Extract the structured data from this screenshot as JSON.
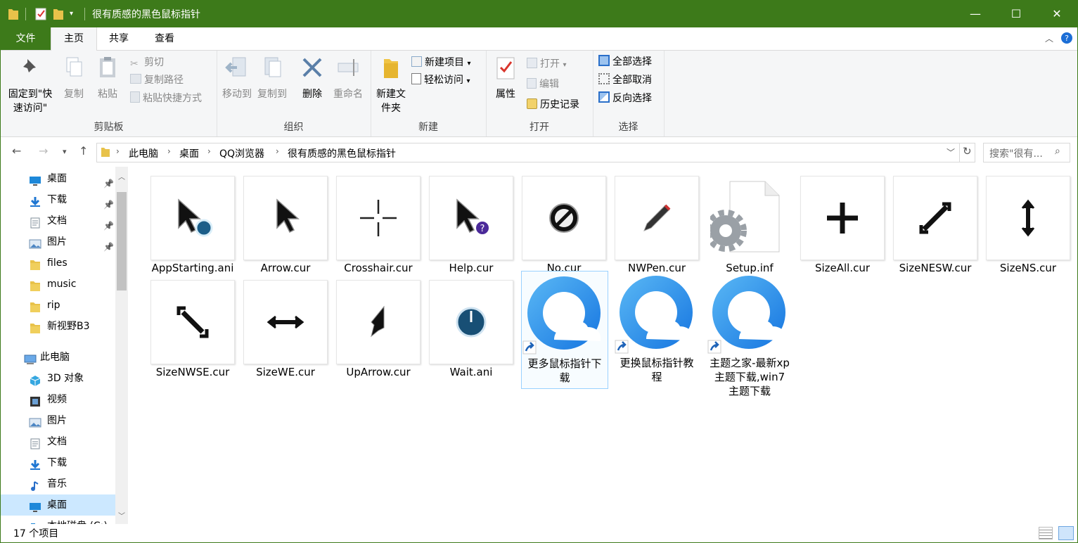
{
  "window": {
    "title": "很有质感的黑色鼠标指针",
    "accent": "#3d7a1a",
    "controls": {
      "minimize": "—",
      "maximize": "☐",
      "close": "✕"
    }
  },
  "ribbon_tabs": [
    "文件",
    "主页",
    "共享",
    "查看"
  ],
  "ribbon": {
    "clipboard": {
      "label": "剪贴板",
      "pin": "固定到\"快速访问\"",
      "copy": "复制",
      "paste": "粘贴",
      "cut": "剪切",
      "copy_path": "复制路径",
      "paste_shortcut": "粘贴快捷方式"
    },
    "organize": {
      "label": "组织",
      "move_to": "移动到",
      "copy_to": "复制到",
      "delete": "删除",
      "rename": "重命名"
    },
    "new": {
      "label": "新建",
      "new_folder": "新建文件夹",
      "new_item": "新建项目",
      "easy_access": "轻松访问"
    },
    "open": {
      "label": "打开",
      "properties": "属性",
      "open": "打开",
      "edit": "编辑",
      "history": "历史记录"
    },
    "select": {
      "label": "选择",
      "select_all": "全部选择",
      "select_none": "全部取消",
      "invert": "反向选择"
    }
  },
  "address": {
    "breadcrumbs": [
      "此电脑",
      "桌面",
      "QQ浏览器",
      "很有质感的黑色鼠标指针"
    ],
    "search_placeholder": "搜索\"很有..."
  },
  "nav_pane": [
    {
      "label": "桌面",
      "icon": "desktop-icon",
      "pinned": true
    },
    {
      "label": "下载",
      "icon": "download-icon",
      "pinned": true
    },
    {
      "label": "文档",
      "icon": "document-icon",
      "pinned": true
    },
    {
      "label": "图片",
      "icon": "picture-icon",
      "pinned": true
    },
    {
      "label": "files",
      "icon": "folder-icon",
      "pinned": false
    },
    {
      "label": "music",
      "icon": "folder-icon",
      "pinned": false
    },
    {
      "label": "rip",
      "icon": "folder-icon",
      "pinned": false
    },
    {
      "label": "新视野B3",
      "icon": "folder-icon",
      "pinned": false
    },
    {
      "label": "此电脑",
      "icon": "computer-icon",
      "pinned": false
    },
    {
      "label": "3D 对象",
      "icon": "3d-objects-icon",
      "pinned": false
    },
    {
      "label": "视频",
      "icon": "video-icon",
      "pinned": false
    },
    {
      "label": "图片",
      "icon": "picture-icon",
      "pinned": false
    },
    {
      "label": "文档",
      "icon": "document-icon",
      "pinned": false
    },
    {
      "label": "下载",
      "icon": "download-icon",
      "pinned": false
    },
    {
      "label": "音乐",
      "icon": "music-icon",
      "pinned": false
    },
    {
      "label": "桌面",
      "icon": "desktop-icon",
      "pinned": false,
      "selected": true
    },
    {
      "label": "本地磁盘 (C:)",
      "icon": "drive-icon",
      "pinned": false
    }
  ],
  "files": [
    {
      "name": "AppStarting.ani",
      "icon": "busy-pointer-icon"
    },
    {
      "name": "Arrow.cur",
      "icon": "arrow-pointer-icon"
    },
    {
      "name": "Crosshair.cur",
      "icon": "crosshair-icon"
    },
    {
      "name": "Help.cur",
      "icon": "help-pointer-icon"
    },
    {
      "name": "No.cur",
      "icon": "no-entry-icon"
    },
    {
      "name": "NWPen.cur",
      "icon": "pen-icon"
    },
    {
      "name": "Setup.inf",
      "icon": "setup-gear-icon"
    },
    {
      "name": "SizeAll.cur",
      "icon": "size-all-icon"
    },
    {
      "name": "SizeNESW.cur",
      "icon": "size-nesw-icon"
    },
    {
      "name": "SizeNS.cur",
      "icon": "size-ns-icon"
    },
    {
      "name": "SizeNWSE.cur",
      "icon": "size-nwse-icon"
    },
    {
      "name": "SizeWE.cur",
      "icon": "size-we-icon"
    },
    {
      "name": "UpArrow.cur",
      "icon": "up-arrow-icon"
    },
    {
      "name": "Wait.ani",
      "icon": "wait-icon"
    },
    {
      "name": "更多鼠标指针下载",
      "icon": "qq-browser-shortcut-icon",
      "selected": true
    },
    {
      "name": "更换鼠标指针教程",
      "icon": "qq-browser-shortcut-icon"
    },
    {
      "name": "主题之家-最新xp主题下载,win7主题下载",
      "icon": "qq-browser-shortcut-icon"
    }
  ],
  "status": {
    "count": "17 个项目"
  }
}
